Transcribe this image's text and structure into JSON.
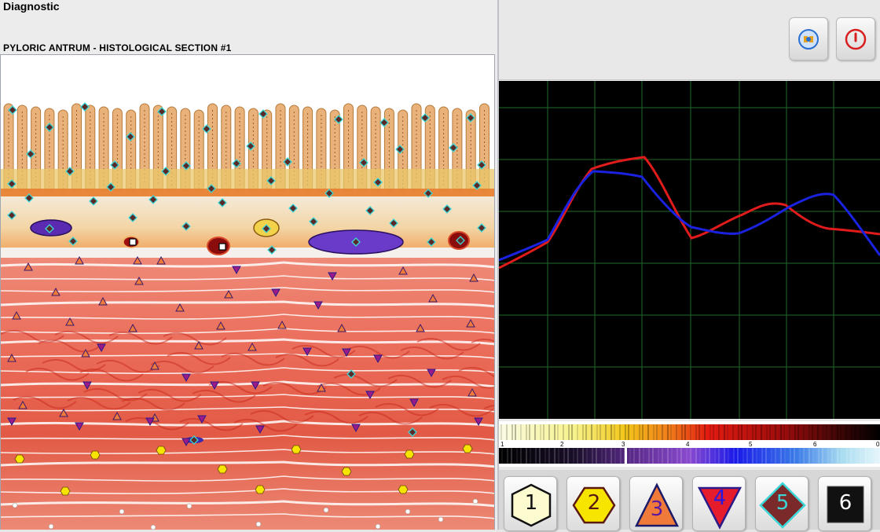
{
  "window": {
    "title": "Diagnostic"
  },
  "section": {
    "title": "PYLORIC ANTRUM - HISTOLOGICAL SECTION #1"
  },
  "toolbar": {
    "buttons": [
      {
        "name": "speaker-icon",
        "color": "#2a6fd0"
      },
      {
        "name": "power-icon",
        "color": "#d81e1e"
      }
    ]
  },
  "graph": {
    "background": "#000000",
    "grid_color": "#1f6b2a",
    "series": [
      {
        "color": "#e01b1b"
      },
      {
        "color": "#1a22e0"
      }
    ]
  },
  "scales": {
    "labels": [
      "1",
      "2",
      "3",
      "4",
      "5",
      "6",
      "0"
    ]
  },
  "markers": {
    "buttons": [
      {
        "label": "1",
        "shape": "hexagon",
        "fill": "#fdfbd0"
      },
      {
        "label": "2",
        "shape": "hexagon",
        "fill": "#f7e500"
      },
      {
        "label": "3",
        "shape": "triangle-up",
        "fill": "#f07a3a"
      },
      {
        "label": "4",
        "shape": "triangle-down",
        "fill": "#e41c2c"
      },
      {
        "label": "5",
        "shape": "diamond",
        "fill": "#7a2a28"
      },
      {
        "label": "6",
        "shape": "square",
        "fill": "#111111"
      }
    ]
  }
}
